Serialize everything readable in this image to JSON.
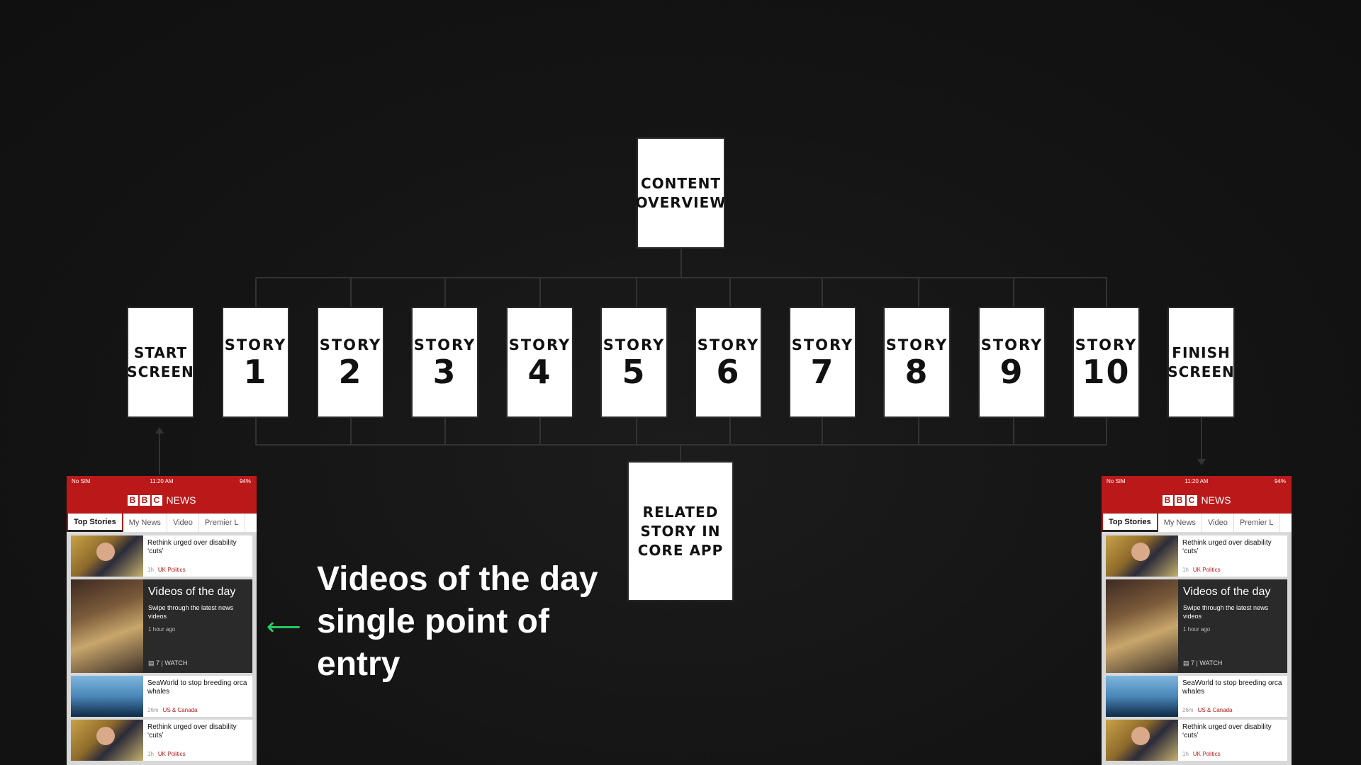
{
  "diagram": {
    "top_node": {
      "line1": "CONTENT",
      "line2": "OVERVIEW"
    },
    "start_node": {
      "line1": "START",
      "line2": "SCREEN"
    },
    "finish_node": {
      "line1": "FINISH",
      "line2": "SCREEN"
    },
    "story_label": "STORY",
    "stories": [
      "1",
      "2",
      "3",
      "4",
      "5",
      "6",
      "7",
      "8",
      "9",
      "10"
    ],
    "related_node": {
      "line1": "RELATED",
      "line2": "STORY IN",
      "line3": "CORE APP"
    }
  },
  "annotation": {
    "headline": "Videos of the day single point of entry",
    "arrow_color": "#25d366"
  },
  "phone": {
    "status": {
      "carrier": "No SIM",
      "time": "11:20 AM",
      "battery": "94%"
    },
    "brand_letters": [
      "B",
      "B",
      "C"
    ],
    "brand_word": "NEWS",
    "tabs": [
      "Top Stories",
      "My News",
      "Video",
      "Premier L"
    ],
    "items": [
      {
        "title": "Rethink urged over disability ‘cuts’",
        "age": "1h",
        "section": "UK Politics"
      },
      {
        "title": "SeaWorld to stop breeding orca whales",
        "age": "26m",
        "section": "US & Canada"
      },
      {
        "title": "Rethink urged over disability ‘cuts’",
        "age": "1h",
        "section": "UK Politics"
      }
    ],
    "feature": {
      "title": "Videos of the day",
      "subtitle": "Swipe through the latest news videos",
      "age": "1 hour ago",
      "count": "7",
      "watch": "WATCH"
    }
  },
  "colors": {
    "brand_red": "#bb1919",
    "background": "#141414",
    "connector": "#333333"
  }
}
